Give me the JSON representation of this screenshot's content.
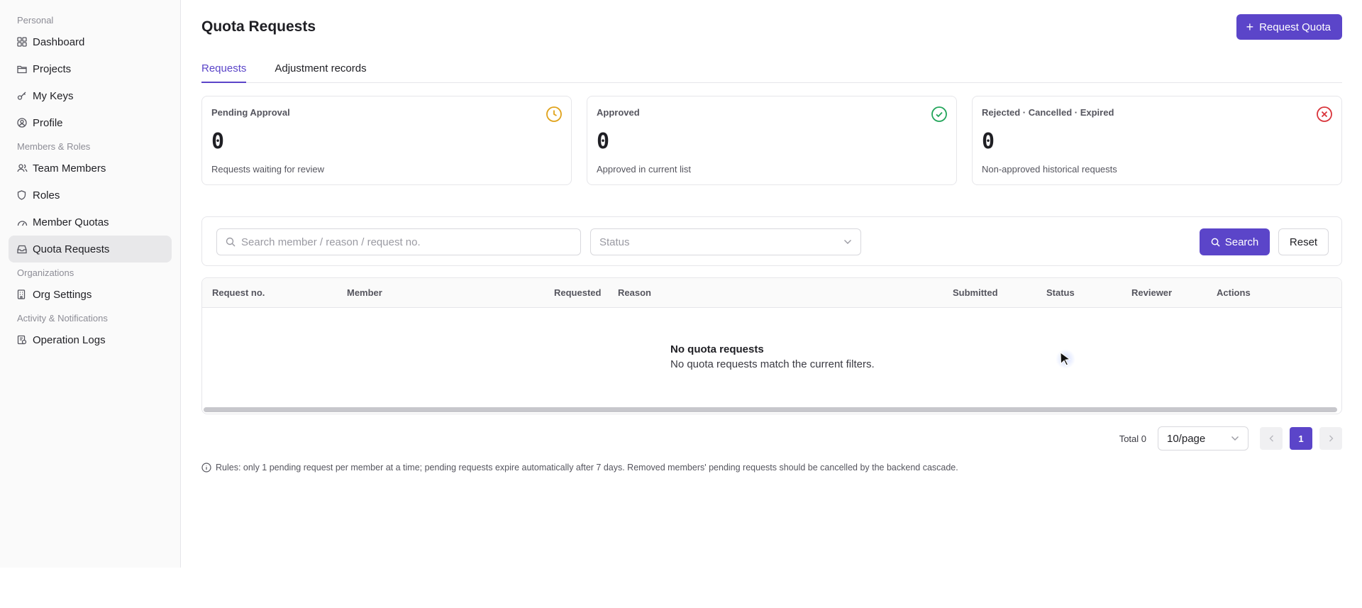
{
  "sidebar": {
    "sections": [
      {
        "label": "Personal",
        "items": [
          {
            "label": "Dashboard",
            "icon": "dashboard-icon"
          },
          {
            "label": "Projects",
            "icon": "folder-icon"
          },
          {
            "label": "My Keys",
            "icon": "key-icon"
          },
          {
            "label": "Profile",
            "icon": "profile-icon"
          }
        ]
      },
      {
        "label": "Members & Roles",
        "items": [
          {
            "label": "Team Members",
            "icon": "users-icon"
          },
          {
            "label": "Roles",
            "icon": "shield-icon"
          },
          {
            "label": "Member Quotas",
            "icon": "gauge-icon"
          },
          {
            "label": "Quota Requests",
            "icon": "inbox-icon",
            "active": true
          }
        ]
      },
      {
        "label": "Organizations",
        "items": [
          {
            "label": "Org Settings",
            "icon": "building-icon"
          }
        ]
      },
      {
        "label": "Activity & Notifications",
        "items": [
          {
            "label": "Operation Logs",
            "icon": "logs-icon"
          }
        ]
      }
    ]
  },
  "header": {
    "title": "Quota Requests",
    "request_button": "Request Quota"
  },
  "tabs": [
    {
      "label": "Requests",
      "active": true
    },
    {
      "label": "Adjustment records",
      "active": false
    }
  ],
  "cards": [
    {
      "title": "Pending Approval",
      "value": "0",
      "desc": "Requests waiting for review",
      "icon": "clock-icon",
      "color": "#e0a21a"
    },
    {
      "title": "Approved",
      "value": "0",
      "desc": "Approved in current list",
      "icon": "check-circle-icon",
      "color": "#22a55a"
    },
    {
      "title": "Rejected · Cancelled · Expired",
      "value": "0",
      "desc": "Non-approved historical requests",
      "icon": "x-circle-icon",
      "color": "#d9343b"
    }
  ],
  "filters": {
    "search_placeholder": "Search member / reason / request no.",
    "search_value": "",
    "status_placeholder": "Status",
    "search_button": "Search",
    "reset_button": "Reset"
  },
  "table": {
    "columns": [
      "Request no.",
      "Member",
      "Requested",
      "Reason",
      "Submitted",
      "Status",
      "Reviewer",
      "Actions"
    ],
    "rows": [],
    "empty_title": "No quota requests",
    "empty_desc": "No quota requests match the current filters."
  },
  "pagination": {
    "total": "Total 0",
    "page_size": "10/page",
    "current_page": "1"
  },
  "rules_text": "Rules: only 1 pending request per member at a time; pending requests expire automatically after 7 days. Removed members' pending requests should be cancelled by the backend cascade.",
  "colors": {
    "accent": "#5b45c9"
  }
}
